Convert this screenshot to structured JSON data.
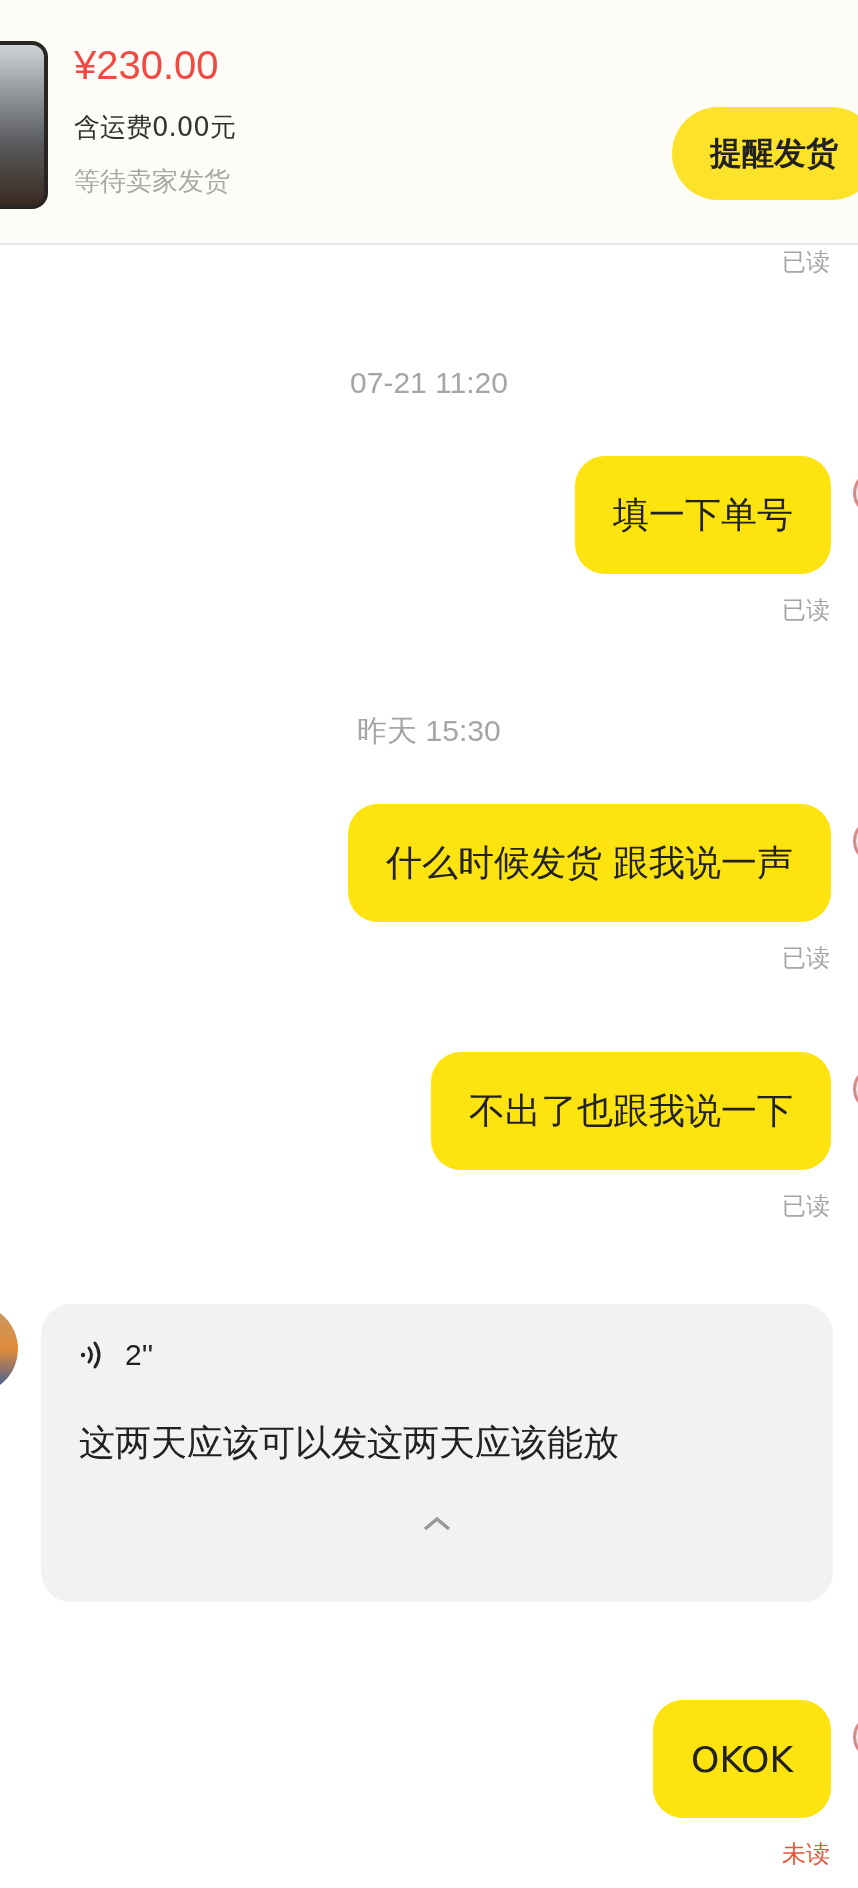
{
  "order": {
    "price": "¥230.00",
    "shipping": "含运费0.00元",
    "status": "等待卖家发货",
    "button": "提醒发货"
  },
  "messages": [
    {
      "kind": "status",
      "status": "已读",
      "read": true
    },
    {
      "kind": "time",
      "text": "07-21 11:20"
    },
    {
      "kind": "outgoing",
      "text": "填一下单号",
      "status": "已读",
      "read": true
    },
    {
      "kind": "time",
      "text": "昨天 15:30"
    },
    {
      "kind": "outgoing",
      "text": "什么时候发货 跟我说一声",
      "status": "已读",
      "read": true
    },
    {
      "kind": "outgoing",
      "text": "不出了也跟我说一下",
      "status": "已读",
      "read": true
    },
    {
      "kind": "voice",
      "duration": "2''",
      "text": "这两天应该可以发这两天应该能放",
      "expanded": true
    },
    {
      "kind": "outgoing",
      "text": "OKOK",
      "status": "未读",
      "read": false
    }
  ]
}
